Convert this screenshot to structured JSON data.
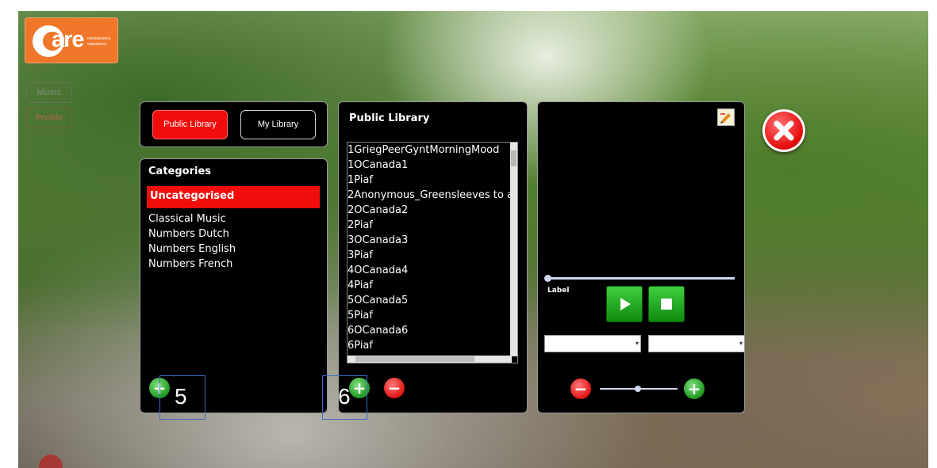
{
  "logo": {
    "word": "are",
    "sub_line1": "reminiscence",
    "sub_line2": "experience"
  },
  "side_buttons": [
    "Music",
    "Profile"
  ],
  "tabs": {
    "public_label": "Public Library",
    "my_label": "My Library"
  },
  "categories": {
    "heading": "Categories",
    "selected": "Uncategorised",
    "items": [
      "Classical Music",
      "Numbers Dutch",
      "Numbers English",
      "Numbers French"
    ]
  },
  "library": {
    "heading": "Public Library",
    "tracks": [
      "1GriegPeerGyntMorningMood",
      "1OCanada1",
      "1Piaf",
      "2Anonymous_Greensleeves to a",
      "2OCanada2",
      "2Piaf",
      "3OCanada3",
      "3Piaf",
      "4OCanada4",
      "4Piaf",
      "5OCanada5",
      "5Piaf",
      "6OCanada6",
      "6Piaf"
    ]
  },
  "player": {
    "label": "Label"
  },
  "annotations": [
    "5",
    "6"
  ],
  "colors": {
    "accent_red": "#f20d0d",
    "panel": "#000000",
    "green": "#1f9a1f"
  },
  "icons": [
    "edit-icon",
    "close-icon",
    "play-icon",
    "stop-icon",
    "plus-icon",
    "minus-icon"
  ]
}
